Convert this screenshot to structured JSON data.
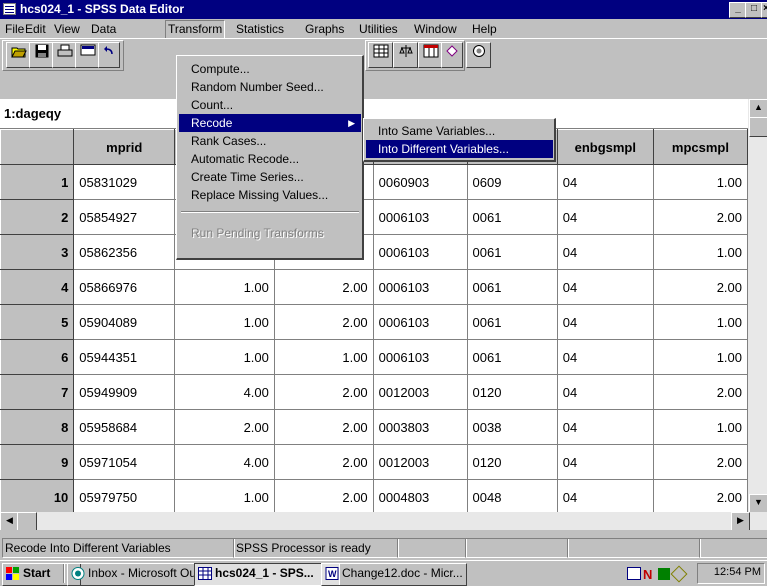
{
  "window": {
    "title": "hcs024_1 - SPSS Data Editor"
  },
  "menubar": [
    "File",
    "Edit",
    "View",
    "Data",
    "Transform",
    "Statistics",
    "Graphs",
    "Utilities",
    "Window",
    "Help"
  ],
  "cell_reference": "1:dageqy",
  "columns": [
    "",
    "mprid",
    "",
    "",
    "",
    "",
    "enbgsmpl",
    "mpcsmpl"
  ],
  "rows": [
    [
      "1",
      "05831029",
      "",
      "",
      "0060903",
      "0609",
      "04",
      "1.00"
    ],
    [
      "2",
      "05854927",
      "",
      "",
      "0006103",
      "0061",
      "04",
      "2.00"
    ],
    [
      "3",
      "05862356",
      "",
      "",
      "0006103",
      "0061",
      "04",
      "1.00"
    ],
    [
      "4",
      "05866976",
      "1.00",
      "2.00",
      "0006103",
      "0061",
      "04",
      "2.00"
    ],
    [
      "5",
      "05904089",
      "1.00",
      "2.00",
      "0006103",
      "0061",
      "04",
      "1.00"
    ],
    [
      "6",
      "05944351",
      "1.00",
      "1.00",
      "0006103",
      "0061",
      "04",
      "1.00"
    ],
    [
      "7",
      "05949909",
      "4.00",
      "2.00",
      "0012003",
      "0120",
      "04",
      "2.00"
    ],
    [
      "8",
      "05958684",
      "2.00",
      "2.00",
      "0003803",
      "0038",
      "04",
      "1.00"
    ],
    [
      "9",
      "05971054",
      "4.00",
      "2.00",
      "0012003",
      "0120",
      "04",
      "2.00"
    ],
    [
      "10",
      "05979750",
      "1.00",
      "2.00",
      "0004803",
      "0048",
      "04",
      "2.00"
    ]
  ],
  "transform_menu": {
    "items": [
      "Compute...",
      "Random Number Seed...",
      "Count...",
      "Recode",
      "Rank Cases...",
      "Automatic Recode...",
      "Create Time Series...",
      "Replace Missing Values...",
      "Run Pending Transforms"
    ],
    "selected": "Recode",
    "disabled": "Run Pending Transforms"
  },
  "recode_submenu": {
    "items": [
      "Into Same Variables...",
      "Into Different Variables..."
    ],
    "selected": "Into Different Variables..."
  },
  "statusbar": {
    "message": "Recode Into Different Variables",
    "processor": "SPSS Processor is ready"
  },
  "taskbar": {
    "start": "Start",
    "tasks": [
      "Inbox - Microsoft Outl...",
      "hcs024_1 - SPS...",
      "Change12.doc - Micr..."
    ],
    "active_task": "hcs024_1 - SPS...",
    "clock": "12:54 PM"
  }
}
